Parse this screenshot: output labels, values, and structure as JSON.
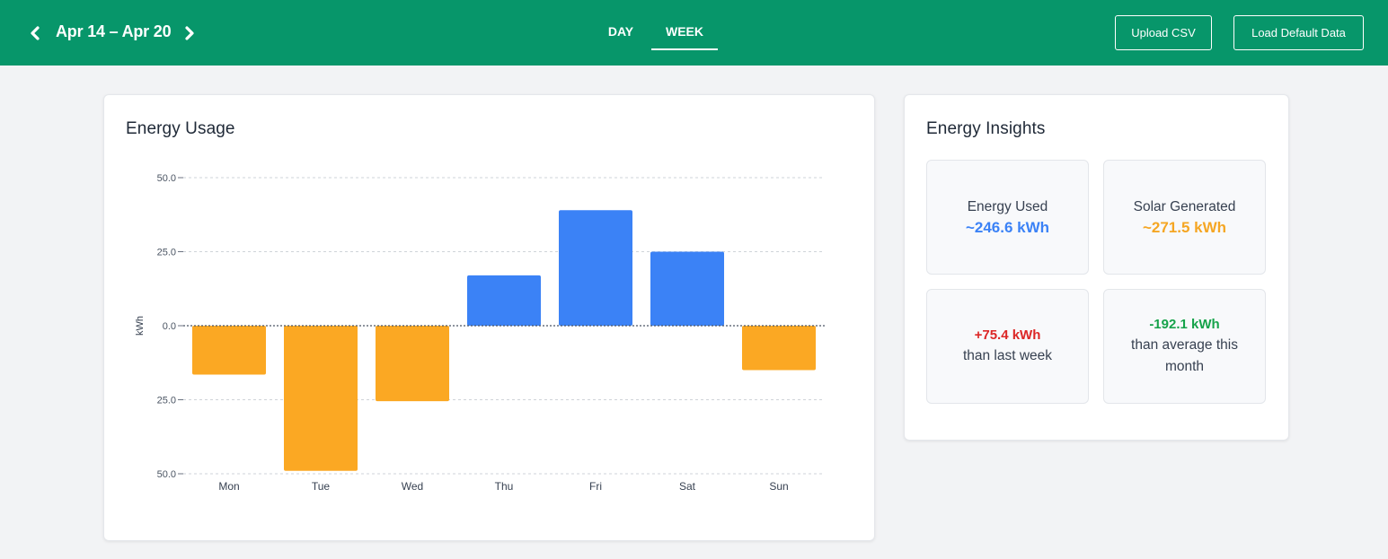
{
  "header": {
    "date_range": "Apr 14 – Apr 20",
    "tabs": [
      {
        "label": "DAY",
        "active": false
      },
      {
        "label": "WEEK",
        "active": true
      }
    ],
    "upload_label": "Upload CSV",
    "load_default_label": "Load Default Data",
    "bg_color": "#07966a"
  },
  "usage_card": {
    "title": "Energy Usage"
  },
  "chart_data": {
    "type": "bar",
    "title": "Energy Usage",
    "ylabel": "kWh",
    "xlabel": "",
    "ylim": [
      -50,
      50
    ],
    "y_ticks": [
      50,
      25,
      0,
      -25,
      -50
    ],
    "y_tick_labels": [
      "50.0",
      "25.0",
      "0.0",
      "25.0",
      "50.0"
    ],
    "categories": [
      "Mon",
      "Tue",
      "Wed",
      "Thu",
      "Fri",
      "Sat",
      "Sun"
    ],
    "values": [
      -16.5,
      -49,
      -25.5,
      17,
      39,
      25,
      -15
    ],
    "grid": true,
    "colors": {
      "positive": "#3b82f6",
      "negative": "#fba823"
    }
  },
  "insights": {
    "title": "Energy Insights",
    "energy_used": {
      "label": "Energy Used",
      "value": "~246.6 kWh",
      "color": "#3b82f6"
    },
    "solar_generated": {
      "label": "Solar Generated",
      "value": "~271.5 kWh",
      "color": "#f5a623"
    },
    "last_week": {
      "delta": "+75.4 kWh",
      "desc": "than last week",
      "color": "#dc2626"
    },
    "month_avg": {
      "delta": "-192.1 kWh",
      "desc": "than average this month",
      "color": "#16a34a"
    }
  }
}
